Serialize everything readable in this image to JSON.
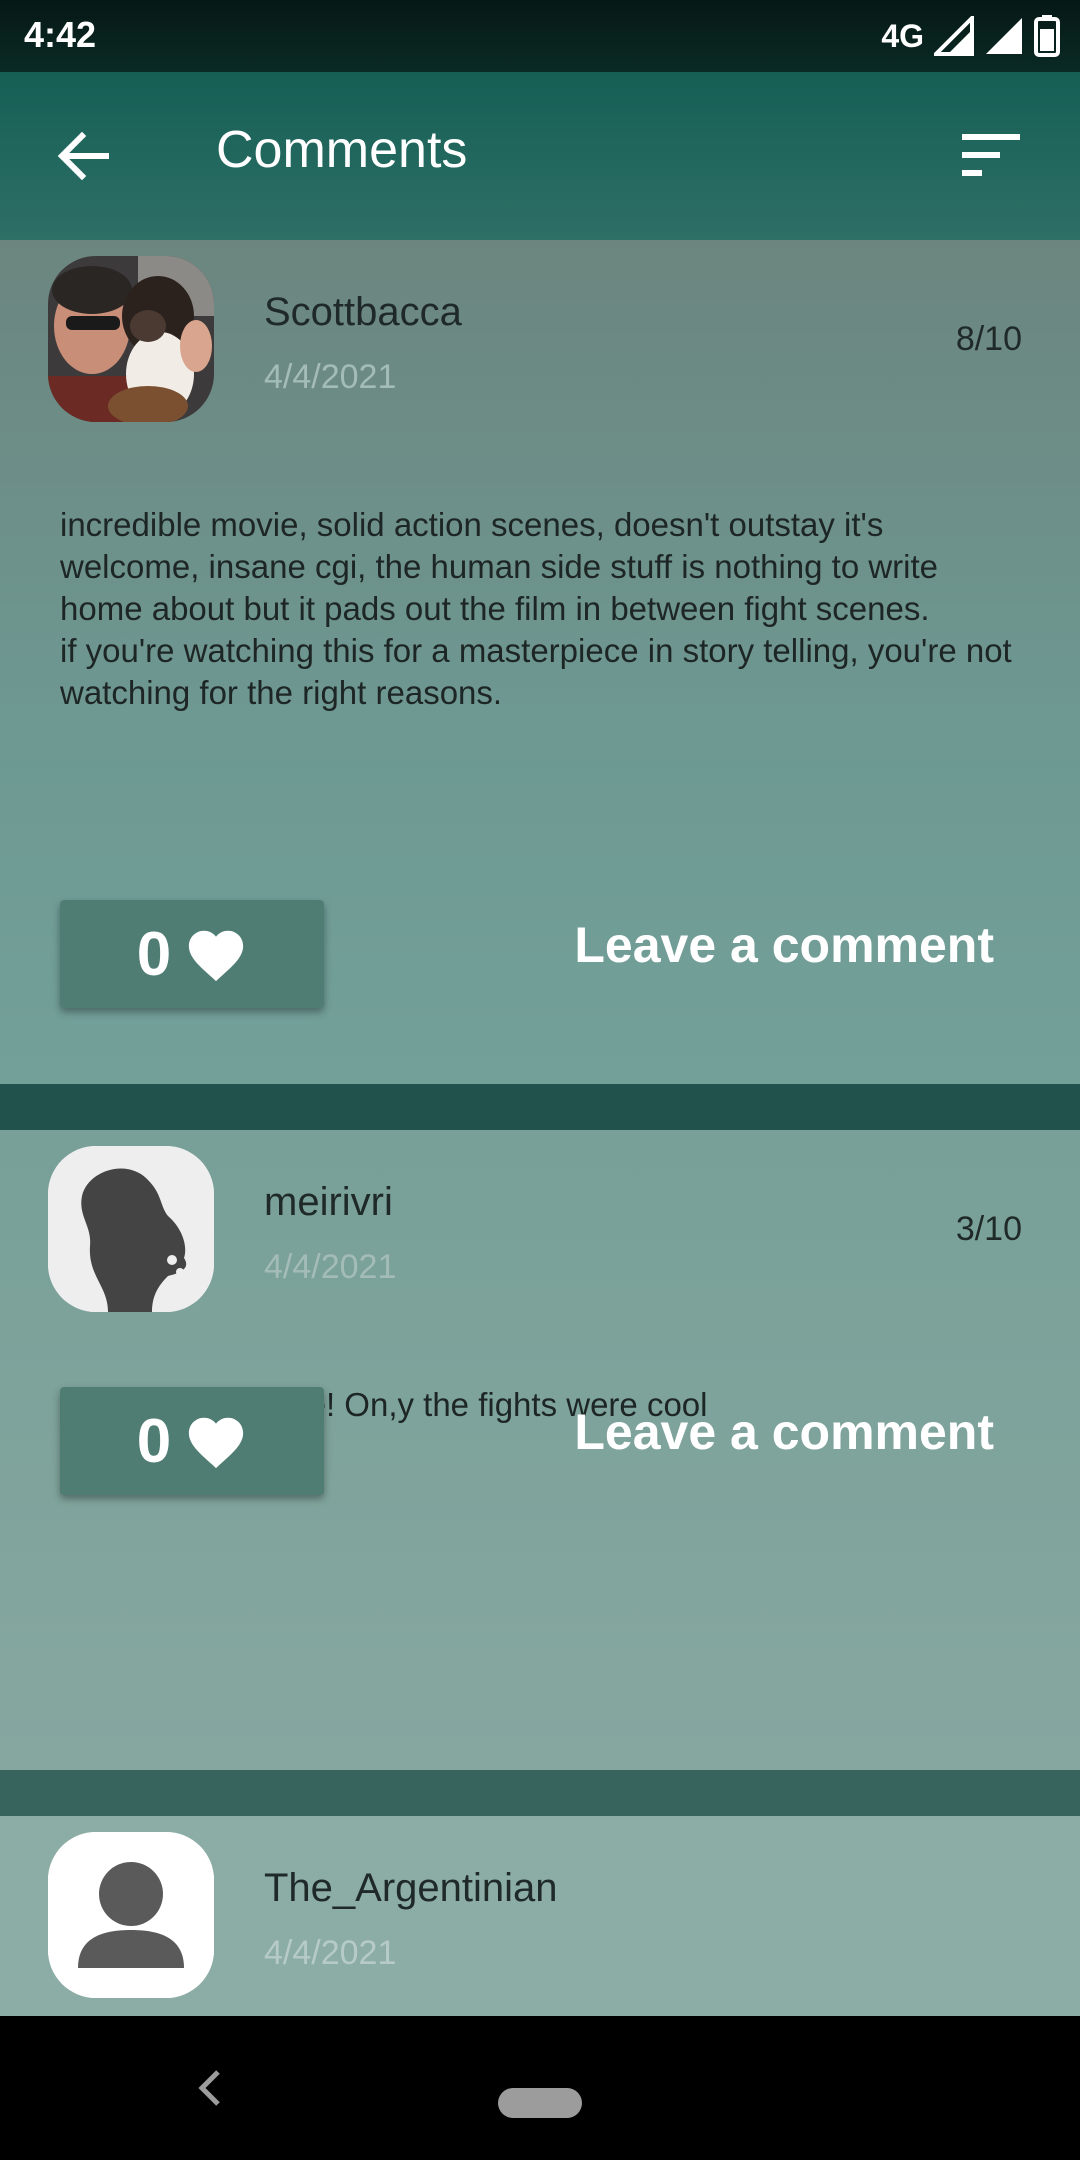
{
  "status_bar": {
    "time": "4:42",
    "network": "4G"
  },
  "app_bar": {
    "title": "Comments"
  },
  "comments": [
    {
      "username": "Scottbacca",
      "date": "4/4/2021",
      "rating": "8/10",
      "text": "incredible movie, solid action scenes, doesn't outstay it's welcome, insane cgi, the human side stuff is nothing to write home about but it pads out the film in between fight scenes.\nif you're watching this for a masterpiece in story telling, you're not watching for the right reasons.",
      "likes": "0",
      "leave_label": "Leave a comment"
    },
    {
      "username": "meirivri",
      "date": "4/4/2021",
      "rating": "3/10",
      "text": "What a bad movie! On,y the fights were cool",
      "likes": "0",
      "leave_label": "Leave a comment"
    },
    {
      "username": "The_Argentinian",
      "date": "4/4/2021"
    }
  ],
  "colors": {
    "accent": "#155f55",
    "like_button": "#4f7d74",
    "separator": "#21534c"
  },
  "icons": {
    "back": "arrow-left-icon",
    "sort": "sort-icon",
    "like": "heart-icon"
  }
}
